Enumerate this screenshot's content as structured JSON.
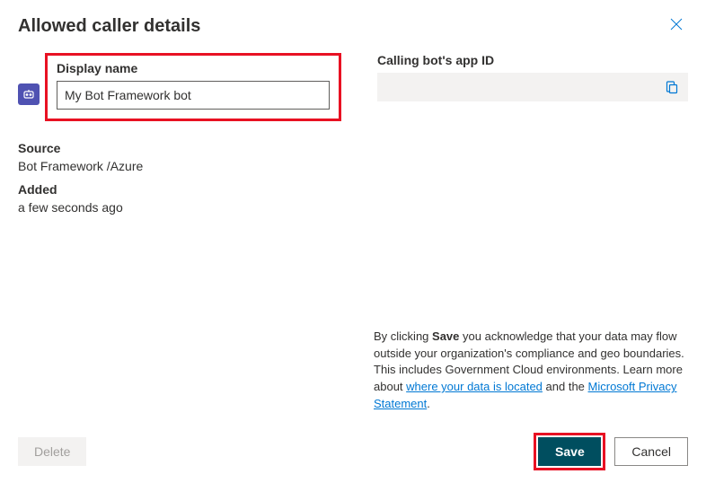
{
  "panel": {
    "title": "Allowed caller details"
  },
  "displayName": {
    "label": "Display name",
    "value": "My Bot Framework bot"
  },
  "source": {
    "label": "Source",
    "value": "Bot Framework /Azure"
  },
  "added": {
    "label": "Added",
    "value": "a few seconds ago"
  },
  "appId": {
    "label": "Calling bot's app ID",
    "value": ""
  },
  "disclaimer": {
    "prefix": "By clicking ",
    "strong": "Save",
    "middle": " you acknowledge that your data may flow outside your organization's compliance and geo boundaries. This includes Government Cloud environments. Learn more about ",
    "link1": "where your data is located",
    "between": " and the ",
    "link2": "Microsoft Privacy Statement",
    "suffix": "."
  },
  "buttons": {
    "delete": "Delete",
    "save": "Save",
    "cancel": "Cancel"
  }
}
